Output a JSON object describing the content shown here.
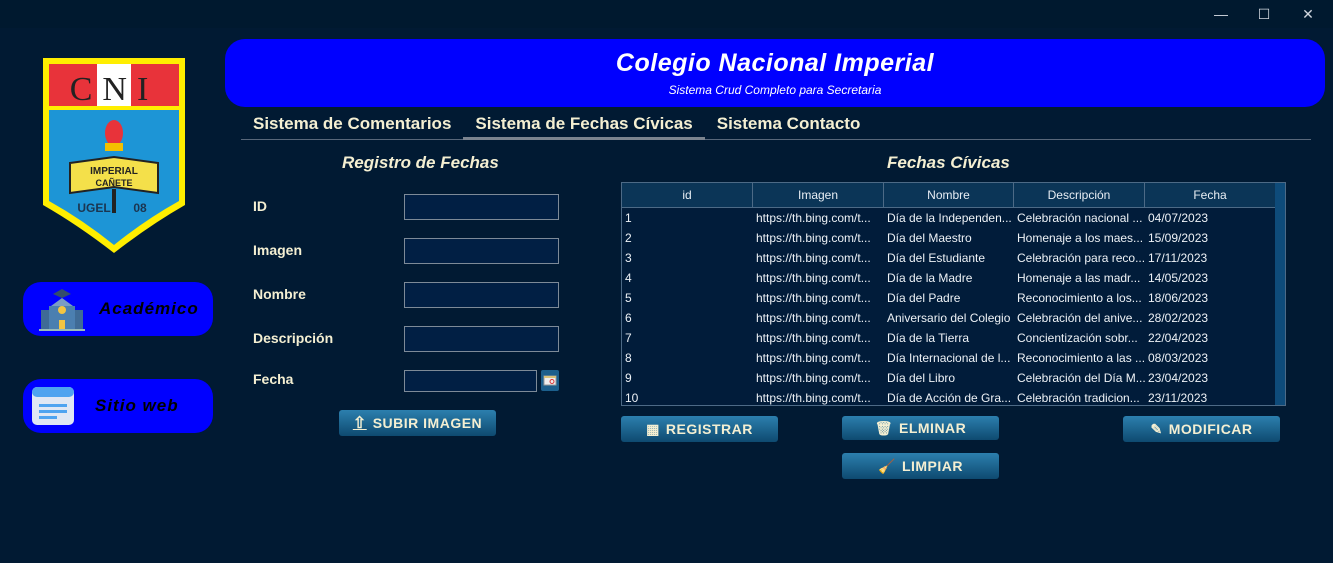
{
  "window": {
    "minimize": "—",
    "maximize": "☐",
    "close": "✕"
  },
  "sidebar": {
    "logo_text": {
      "top": "CNI",
      "band": "IMPERIAL",
      "band2": "CAÑETE",
      "bottom": "UGEL 08"
    },
    "items": [
      {
        "label": "Académico",
        "icon": "school-icon"
      },
      {
        "label": "Sitio web",
        "icon": "website-icon"
      }
    ]
  },
  "header": {
    "title": "Colegio Nacional Imperial",
    "subtitle": "Sistema Crud Completo para Secretaria"
  },
  "tabs": [
    {
      "label": "Sistema de Comentarios",
      "active": false
    },
    {
      "label": "Sistema de Fechas Cívicas",
      "active": true
    },
    {
      "label": "Sistema Contacto",
      "active": false
    }
  ],
  "form": {
    "title": "Registro de Fechas",
    "fields": [
      {
        "label": "ID",
        "value": ""
      },
      {
        "label": "Imagen",
        "value": ""
      },
      {
        "label": "Nombre",
        "value": ""
      },
      {
        "label": "Descripción",
        "value": ""
      },
      {
        "label": "Fecha",
        "value": ""
      }
    ],
    "upload_label": "SUBIR IMAGEN"
  },
  "table": {
    "title": "Fechas Cívicas",
    "columns": [
      "id",
      "Imagen",
      "Nombre",
      "Descripción",
      "Fecha"
    ],
    "rows": [
      [
        "1",
        "https://th.bing.com/t...",
        "Día de la Independen...",
        "Celebración nacional ...",
        "04/07/2023"
      ],
      [
        "2",
        "https://th.bing.com/t...",
        "Día del Maestro",
        "Homenaje a los maes...",
        "15/09/2023"
      ],
      [
        "3",
        "https://th.bing.com/t...",
        "Día del Estudiante",
        "Celebración para reco...",
        "17/11/2023"
      ],
      [
        "4",
        "https://th.bing.com/t...",
        "Día de la Madre",
        "Homenaje a las madr...",
        "14/05/2023"
      ],
      [
        "5",
        "https://th.bing.com/t...",
        "Día del Padre",
        "Reconocimiento a los...",
        "18/06/2023"
      ],
      [
        "6",
        "https://th.bing.com/t...",
        "Aniversario del Colegio",
        "Celebración del anive...",
        "28/02/2023"
      ],
      [
        "7",
        "https://th.bing.com/t...",
        "Día de la Tierra",
        "Concientización sobr...",
        "22/04/2023"
      ],
      [
        "8",
        "https://th.bing.com/t...",
        "Día Internacional de l...",
        "Reconocimiento a las ...",
        "08/03/2023"
      ],
      [
        "9",
        "https://th.bing.com/t...",
        "Día del Libro",
        "Celebración del Día M...",
        "23/04/2023"
      ],
      [
        "10",
        "https://th.bing.com/t...",
        "Día de Acción de Gra...",
        "Celebración tradicion...",
        "23/11/2023"
      ]
    ]
  },
  "actions": {
    "registrar": "REGISTRAR",
    "eliminar": "ELMINAR",
    "modificar": "MODIFICAR",
    "limpiar": "LIMPIAR"
  }
}
